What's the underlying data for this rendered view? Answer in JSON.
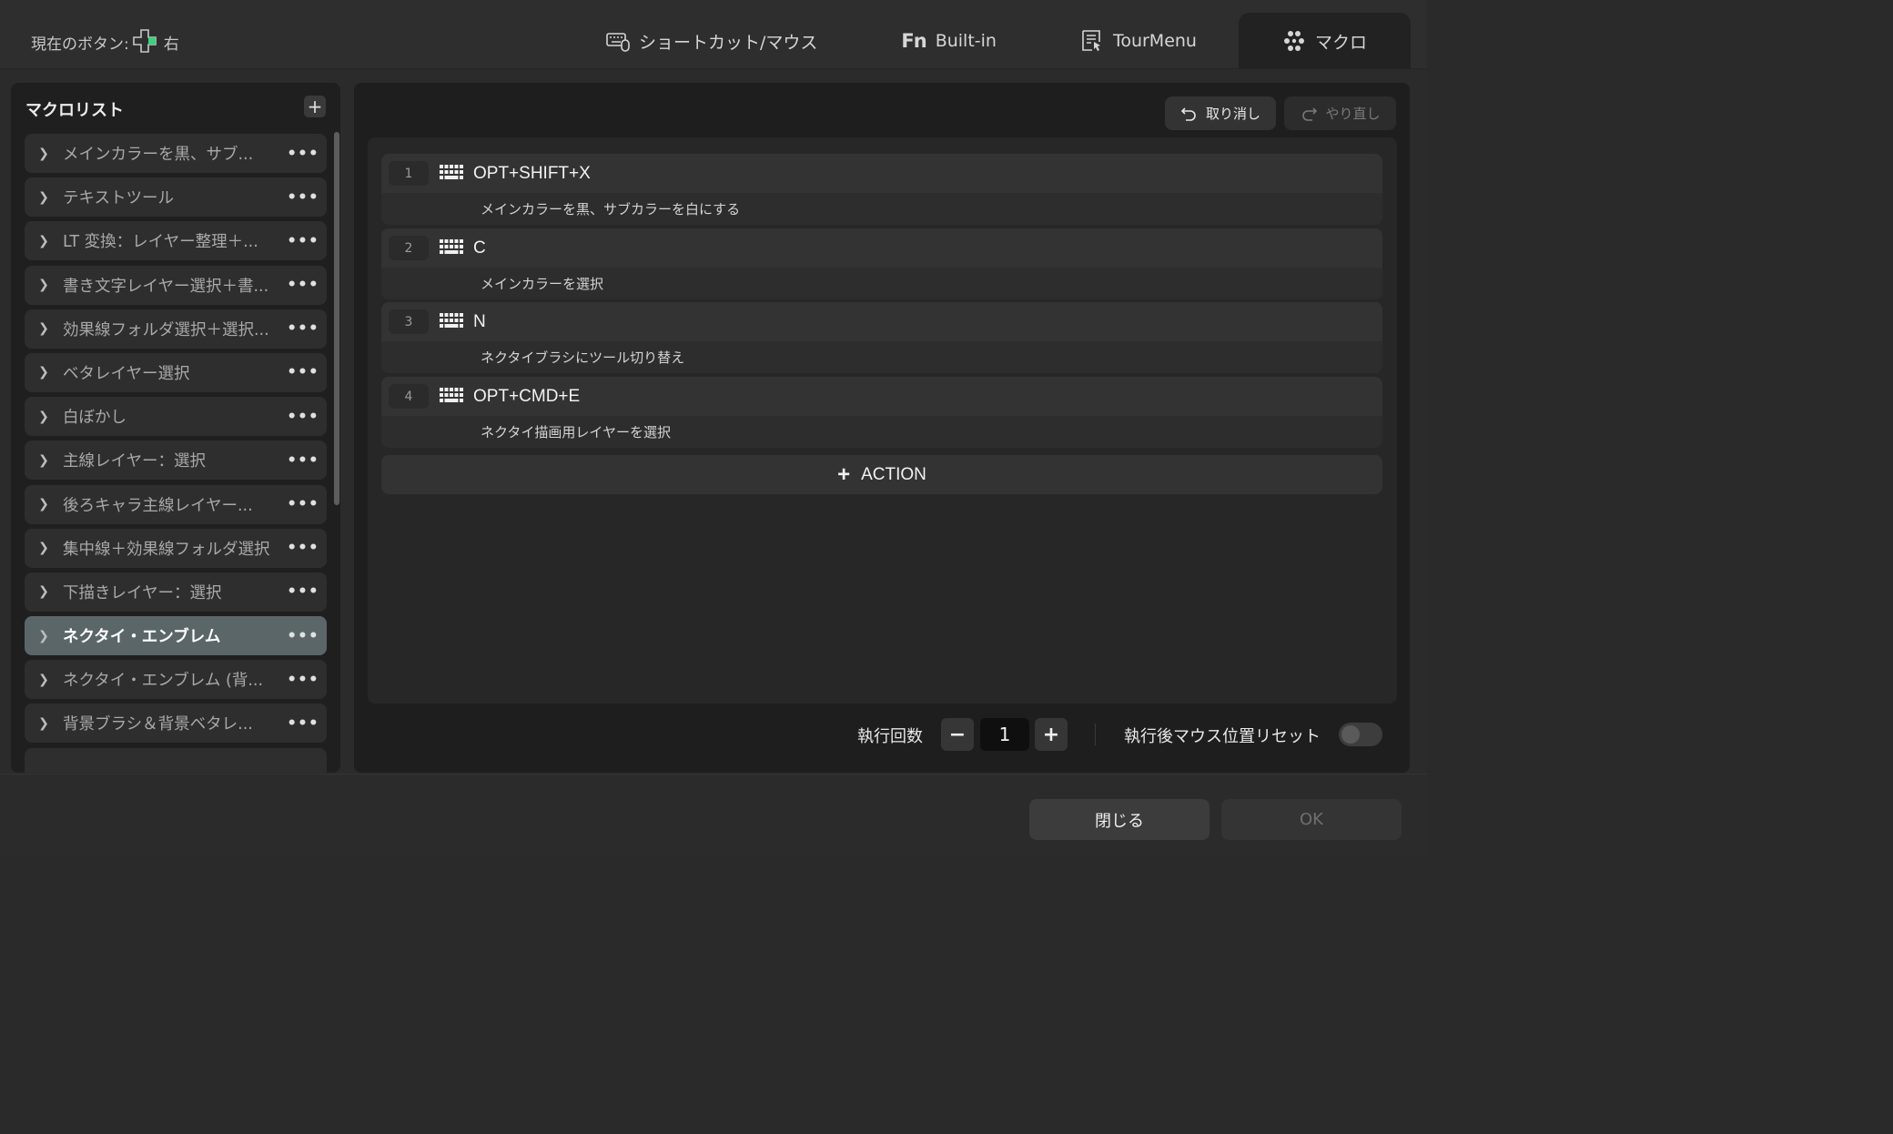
{
  "header": {
    "current_button_label": "現在のボタン:",
    "current_button_value": "右",
    "tabs": [
      {
        "label": "ショートカット/マウス",
        "icon": "keyboard-mouse-icon"
      },
      {
        "label": "Built-in",
        "icon": "fn-icon"
      },
      {
        "label": "TourMenu",
        "icon": "tourmenu-icon"
      },
      {
        "label": "マクロ",
        "icon": "macro-icon",
        "active": true
      }
    ]
  },
  "macro_list": {
    "title": "マクロリスト",
    "add_label": "+",
    "items": [
      {
        "label": "メインカラーを黒、サブ..."
      },
      {
        "label": "テキストツール"
      },
      {
        "label": "LT 変換：レイヤー整理＋..."
      },
      {
        "label": "書き文字レイヤー選択＋書..."
      },
      {
        "label": "効果線フォルダ選択＋選択..."
      },
      {
        "label": "ベタレイヤー選択"
      },
      {
        "label": "白ぼかし"
      },
      {
        "label": "主線レイヤー：選択"
      },
      {
        "label": "後ろキャラ主線レイヤー..."
      },
      {
        "label": "集中線＋効果線フォルダ選択"
      },
      {
        "label": "下描きレイヤー：選択"
      },
      {
        "label": "ネクタイ・エンブレム",
        "selected": true
      },
      {
        "label": "ネクタイ・エンブレム (背..."
      },
      {
        "label": "背景ブラシ＆背景ベタレ..."
      }
    ]
  },
  "editor": {
    "undo_label": "取り消し",
    "redo_label": "やり直し",
    "actions": [
      {
        "index": "1",
        "key": "OPT+SHIFT+X",
        "description": "メインカラーを黒、サブカラーを白にする"
      },
      {
        "index": "2",
        "key": "C",
        "description": "メインカラーを選択"
      },
      {
        "index": "3",
        "key": "N",
        "description": "ネクタイブラシにツール切り替え"
      },
      {
        "index": "4",
        "key": "OPT+CMD+E",
        "description": "ネクタイ描画用レイヤーを選択"
      }
    ],
    "add_action_label": "ACTION",
    "exec_count_label": "執行回数",
    "exec_count_value": "1",
    "reset_mouse_label": "執行後マウス位置リセット",
    "reset_mouse_enabled": false
  },
  "footer": {
    "close_label": "閉じる",
    "ok_label": "OK"
  },
  "colors": {
    "selected_item_bg": "#5b6669",
    "dpad_accent": "#3fd07f"
  }
}
